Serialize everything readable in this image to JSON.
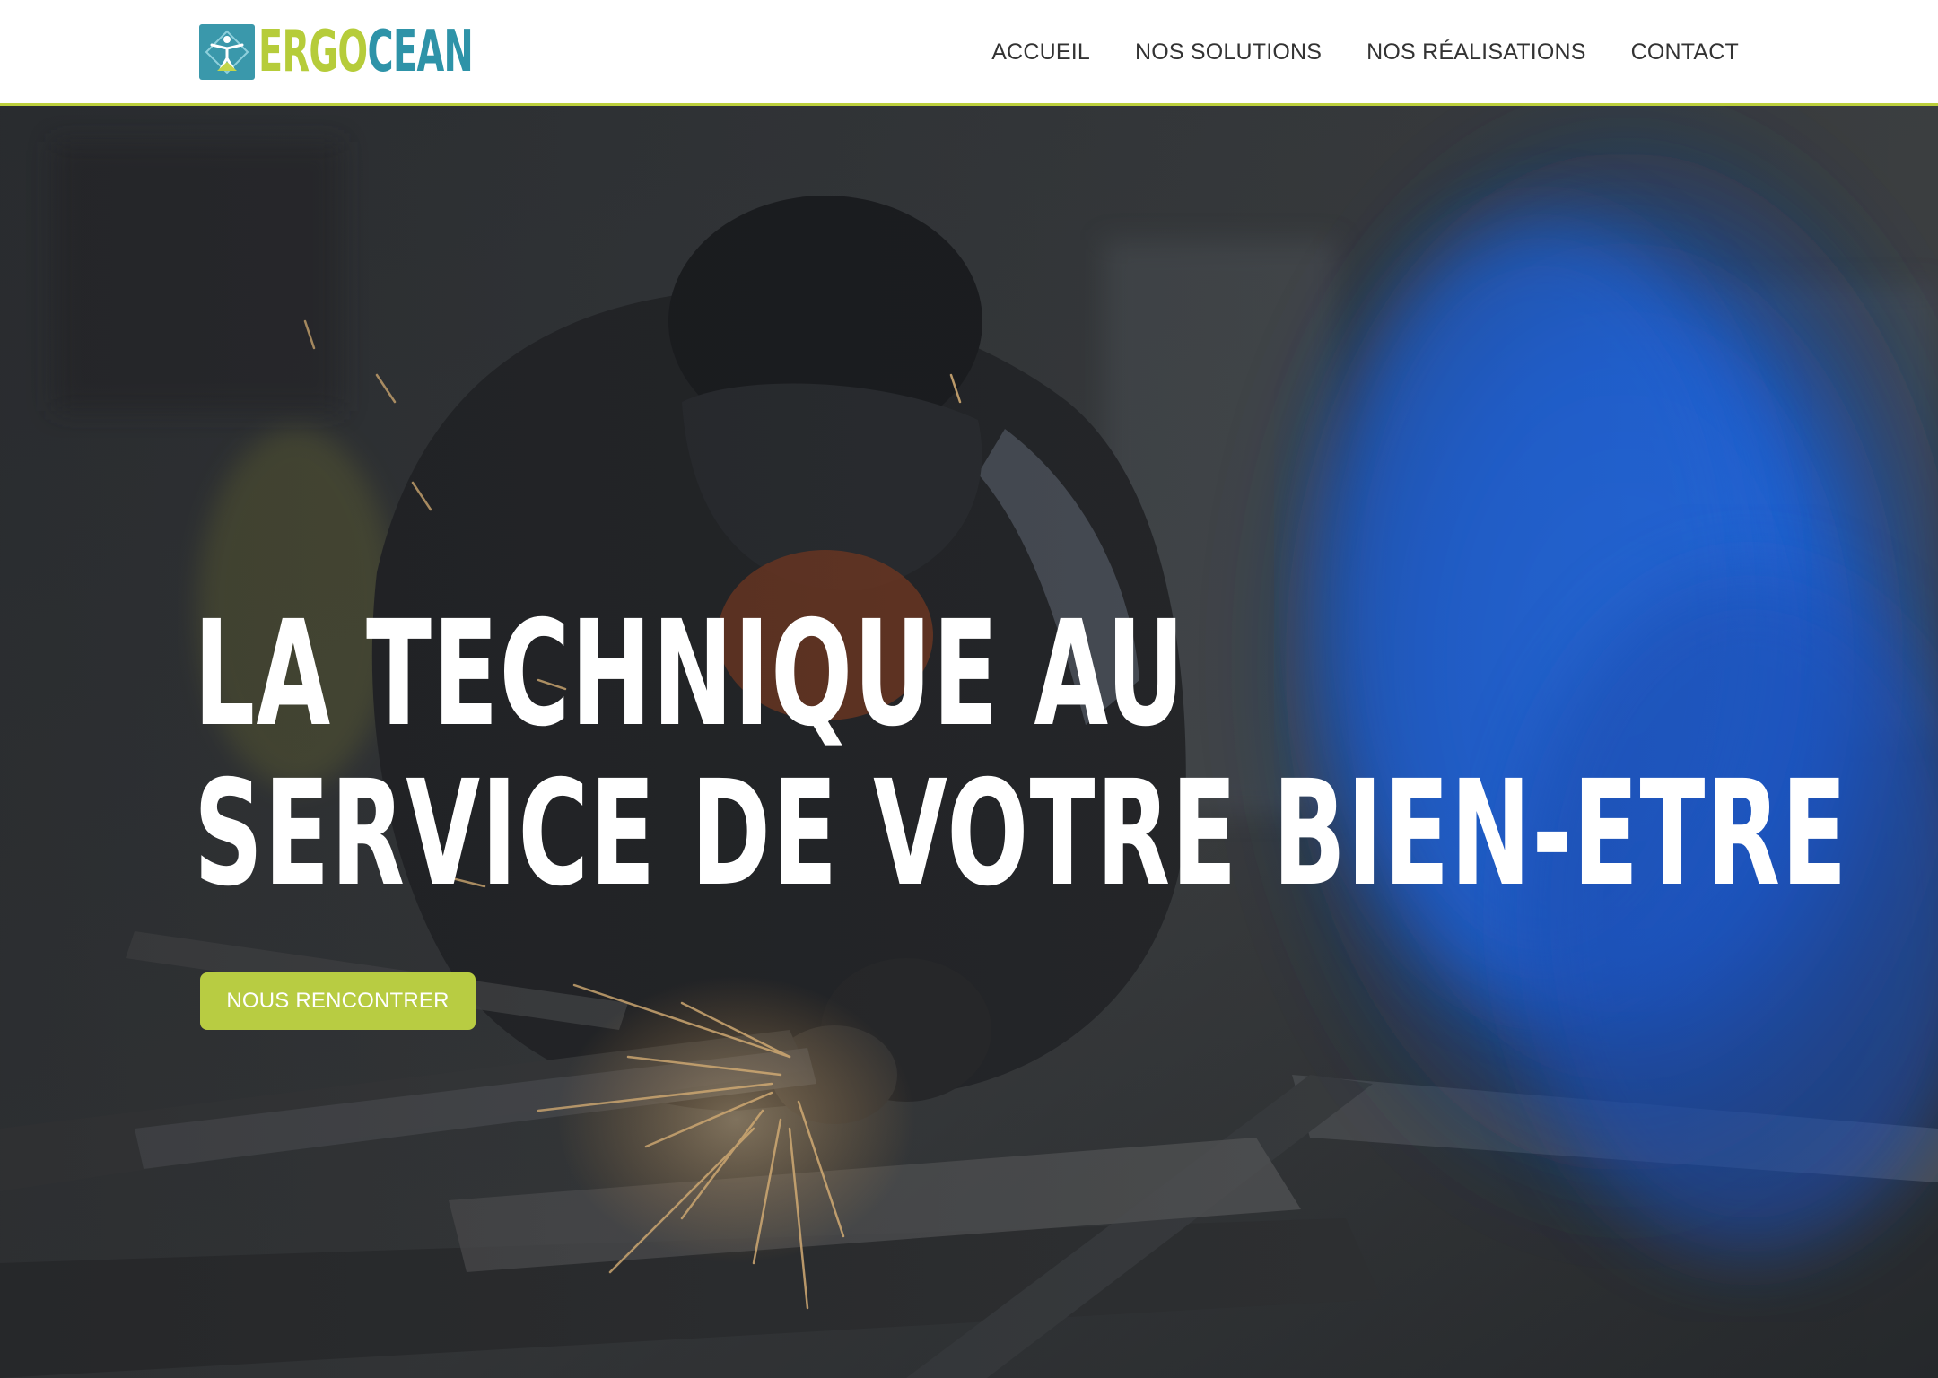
{
  "header": {
    "logo": {
      "text_part_1": "ERGO",
      "text_part_2": "CEAN",
      "icon": "ergonomic-person-icon"
    },
    "nav": [
      {
        "label": "ACCUEIL"
      },
      {
        "label": "NOS SOLUTIONS"
      },
      {
        "label": "NOS RÉALISATIONS"
      },
      {
        "label": "CONTACT"
      }
    ]
  },
  "hero": {
    "title_line_1": "LA TECHNIQUE AU",
    "title_line_2": "SERVICE DE VOTRE BIEN-ETRE",
    "cta_label": "NOUS RENCONTRER",
    "background": "welder-grinding-metal-photo"
  },
  "colors": {
    "brand_green": "#b8cc42",
    "brand_teal": "#2e93a8",
    "header_border": "#bccf3c",
    "nav_text": "#333333"
  }
}
